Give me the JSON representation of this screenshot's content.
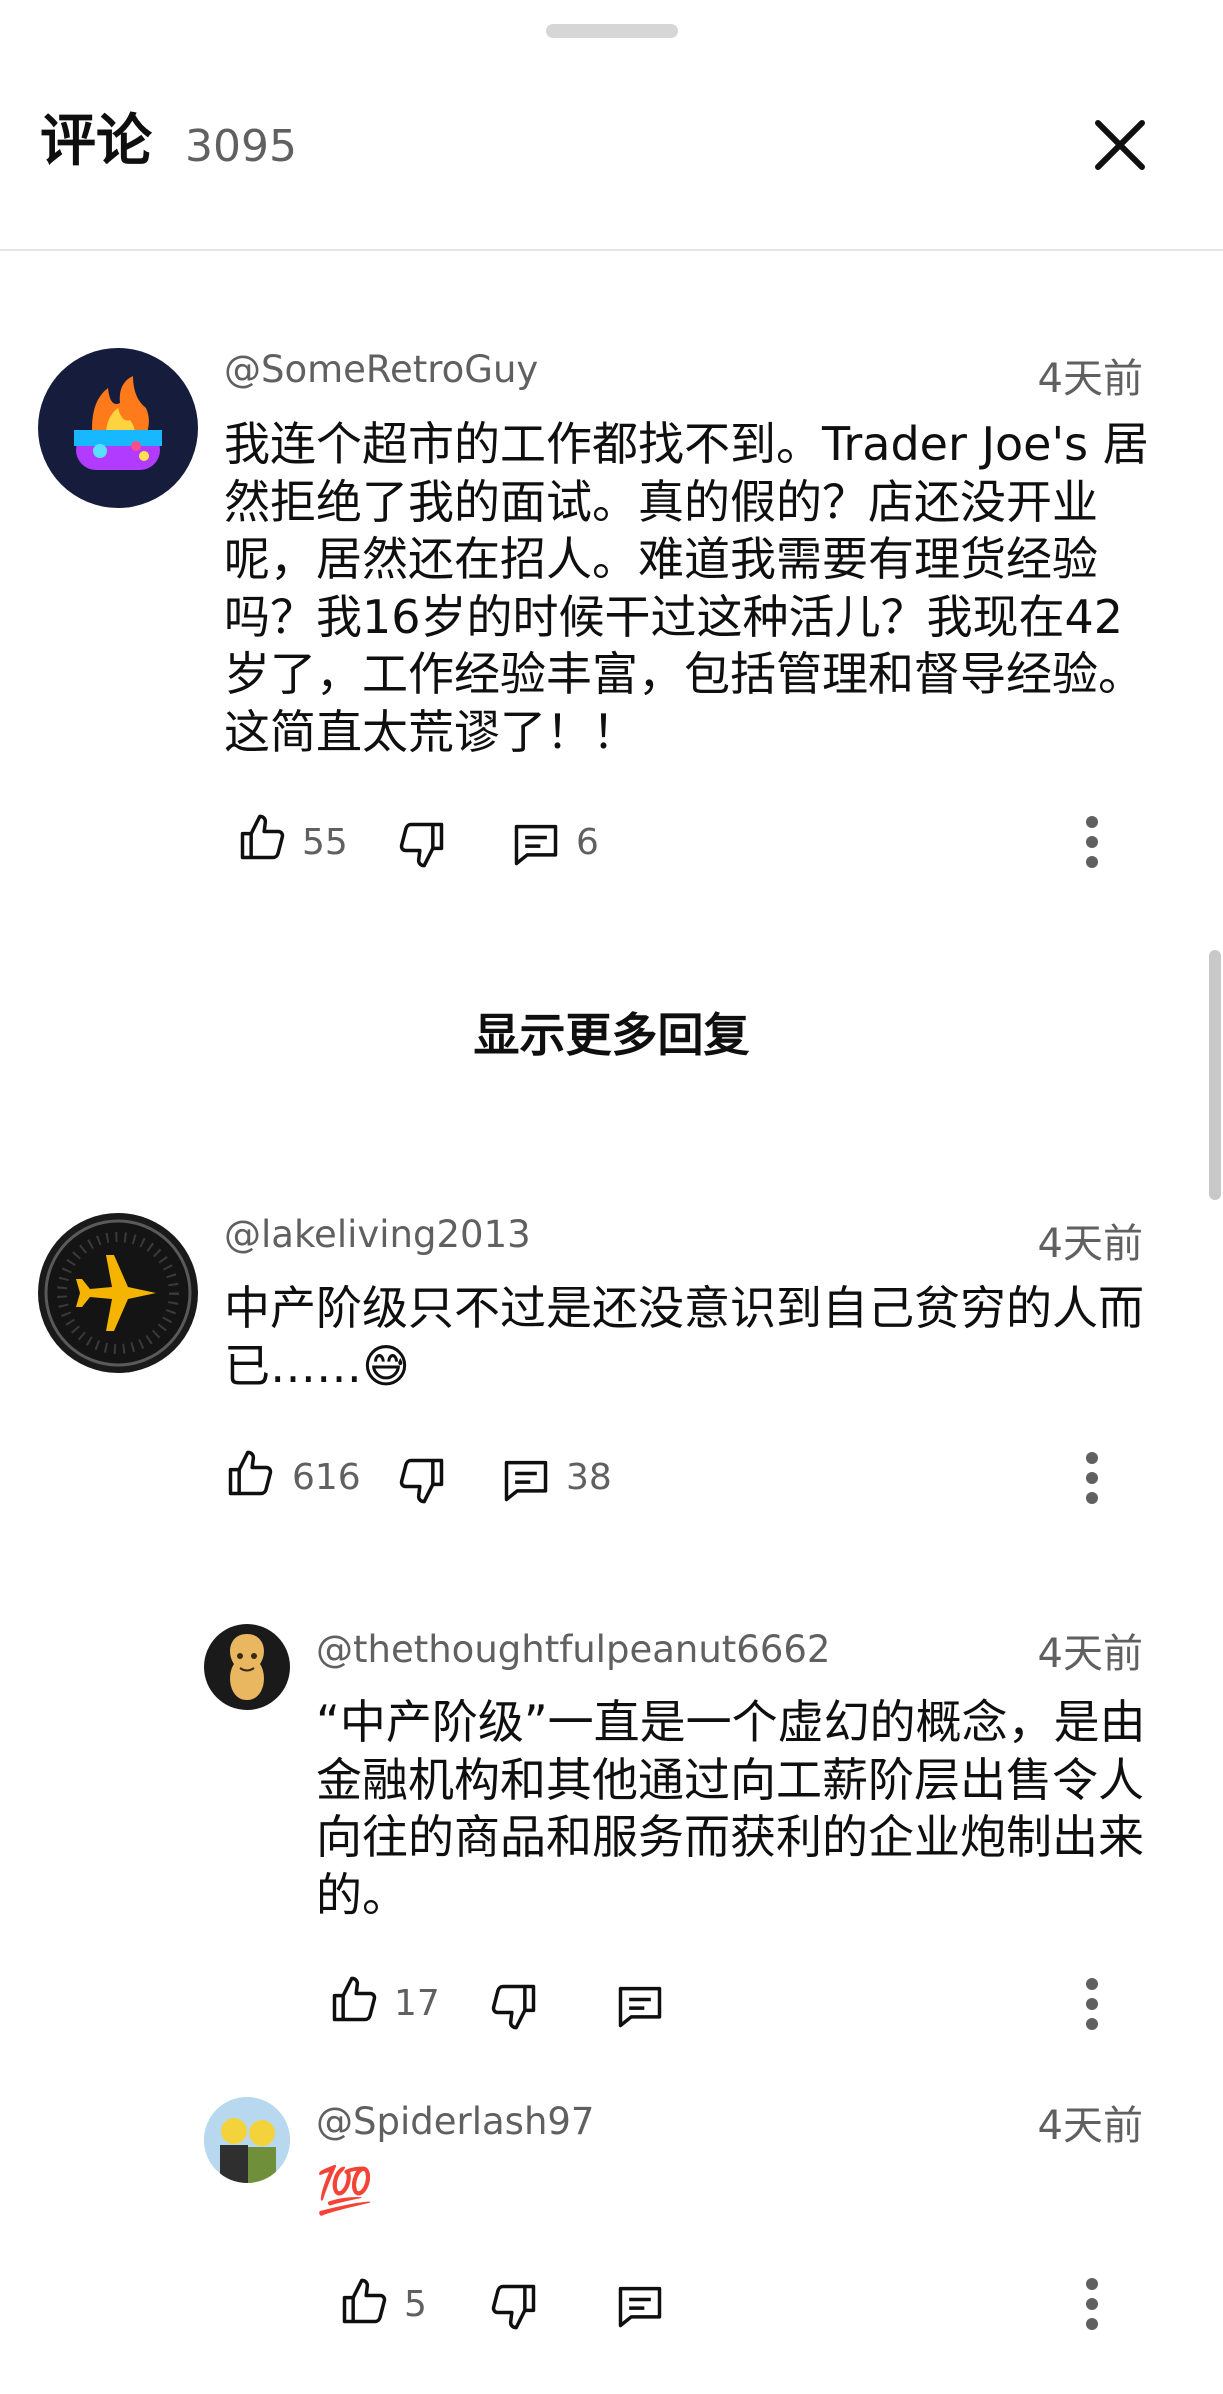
{
  "header": {
    "title": "评论",
    "count": "3095"
  },
  "comments": [
    {
      "author": "@SomeRetroGuy",
      "time": "4天前",
      "text": "我连个超市的工作都找不到。Trader Joe's 居\n然拒绝了我的面试。真的假的？店还没开业\n呢，居然还在招人。难道我需要有理货经验\n吗？我16岁的时候干过这种活儿？我现在42\n岁了，工作经验丰富，包括管理和督导经验。\n这简直太荒谬了！！",
      "likes": "55",
      "replies": "6"
    },
    {
      "author": "@lakeliving2013",
      "time": "4天前",
      "text": "中产阶级只不过是还没意识到自己贫穷的人而\n已……😅",
      "likes": "616",
      "replies": "38"
    }
  ],
  "show_more": "显示更多回复",
  "replies": [
    {
      "author": "@thethoughtfulpeanut6662",
      "time": "4天前",
      "text": "“中产阶级”一直是一个虚幻的概念，是由\n金融机构和其他通过向工薪阶层出售令人\n向往的商品和服务而获利的企业炮制出来\n的。",
      "likes": "17"
    },
    {
      "author": "@Spiderlash97",
      "time": "4天前",
      "text": "💯",
      "likes": "5"
    }
  ]
}
